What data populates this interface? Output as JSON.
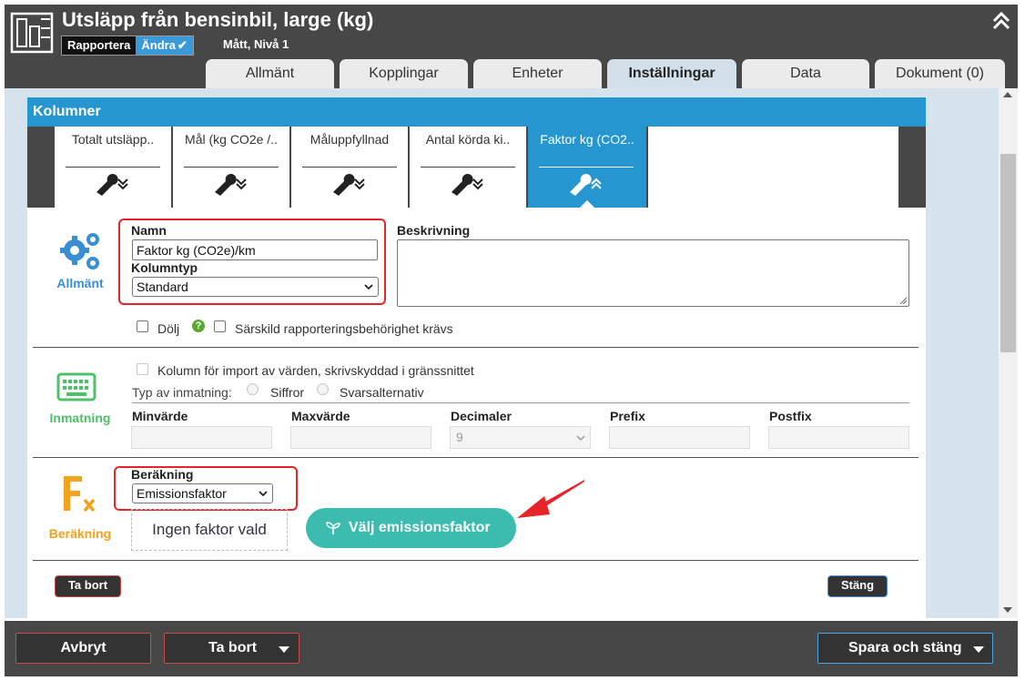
{
  "header": {
    "title": "Utsläpp från bensinbil, large (kg)",
    "mode_report": "Rapportera",
    "mode_edit": "Ändra",
    "level": "Mått, Nivå 1",
    "tabs": [
      "Allmänt",
      "Kopplingar",
      "Enheter",
      "Inställningar",
      "Data",
      "Dokument (0)"
    ],
    "active_tab": "Inställningar"
  },
  "panel": {
    "title": "Kolumner",
    "column_tabs": [
      "Totalt utsläpp..",
      "Mål (kg CO2e /..",
      "Måluppfyllnad",
      "Antal körda ki..",
      "Faktor kg (CO2.."
    ],
    "active_column": "Faktor kg (CO2.."
  },
  "general": {
    "section_label": "Allmänt",
    "name_label": "Namn",
    "name_value": "Faktor kg (CO2e)/km",
    "type_label": "Kolumntyp",
    "type_value": "Standard",
    "desc_label": "Beskrivning",
    "desc_value": "",
    "hide_label": "Dölj",
    "special_label": "Särskild rapporteringsbehörighet krävs"
  },
  "input": {
    "section_label": "Inmatning",
    "import_label": "Kolumn för import av värden, skrivskyddad i gränssnittet",
    "type_label": "Typ av inmatning:",
    "opt_digits": "Siffror",
    "opt_answers": "Svarsalternativ",
    "min_label": "Minvärde",
    "max_label": "Maxvärde",
    "decimals_label": "Decimaler",
    "decimals_value": "9",
    "prefix_label": "Prefix",
    "postfix_label": "Postfix"
  },
  "calculation": {
    "section_label": "Beräkning",
    "calc_label": "Beräkning",
    "calc_value": "Emissionsfaktor",
    "no_factor": "Ingen faktor vald",
    "choose_button": "Välj emissionsfaktor"
  },
  "panel_actions": {
    "delete": "Ta bort",
    "close": "Stäng"
  },
  "footer": {
    "cancel": "Avbryt",
    "delete": "Ta bort",
    "save_close": "Spara och stäng"
  },
  "colors": {
    "accent_blue": "#2596cf",
    "header_gray": "#474747",
    "teal": "#3bbcaf",
    "highlight_red": "#e5252a",
    "general_icon": "#3a8fd1",
    "input_icon": "#4cc167",
    "calc_icon": "#f3a21b"
  },
  "icons": {
    "logo": "database-table-icon",
    "collapse": "double-chevron-up-icon",
    "wrench": "wrench-icon",
    "general": "gears-icon",
    "input": "keyboard-icon",
    "calculation": "function-fx-icon",
    "help": "question-circle-icon",
    "sprout": "sprout-icon"
  }
}
